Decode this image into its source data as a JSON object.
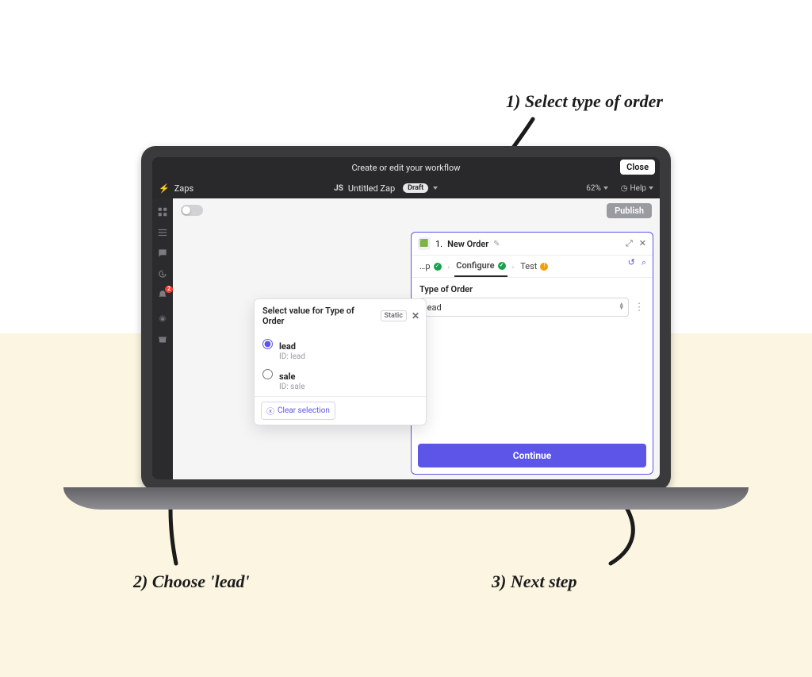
{
  "modal": {
    "title": "Create or edit your workflow",
    "close": "Close"
  },
  "zapsbar": {
    "brand": "Zaps",
    "ws_badge": "JS",
    "zap_name": "Untitled Zap",
    "draft": "Draft",
    "zoom": "62%",
    "help": "Help"
  },
  "action_bar": {
    "publish": "Publish"
  },
  "panel": {
    "step_prefix": "1.",
    "step_title": "New Order",
    "tabs": {
      "setup_short": "…p",
      "configure": "Configure",
      "test": "Test"
    },
    "field_label": "Type of Order",
    "field_value": "lead",
    "continue": "Continue"
  },
  "popover": {
    "title": "Select value for Type of Order",
    "badge": "Static",
    "options": [
      {
        "label": "lead",
        "id_line": "ID: lead",
        "selected": true
      },
      {
        "label": "sale",
        "id_line": "ID: sale",
        "selected": false
      }
    ],
    "clear": "Clear selection"
  },
  "rail_badge_count": "2",
  "annotations": {
    "a1": "1) Select type of order",
    "a2": "2) Choose 'lead'",
    "a3": "3) Next step"
  }
}
